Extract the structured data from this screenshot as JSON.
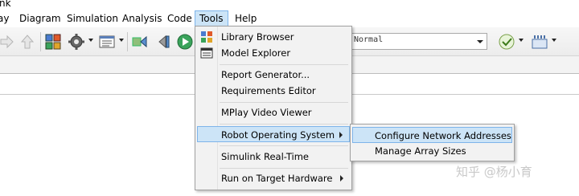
{
  "window": {
    "title_fragment": "nk"
  },
  "menubar": {
    "items": [
      {
        "label": "ay"
      },
      {
        "label": "Diagram"
      },
      {
        "label": "Simulation"
      },
      {
        "label": "Analysis"
      },
      {
        "label": "Code"
      },
      {
        "label": "Tools"
      },
      {
        "label": "Help"
      }
    ],
    "active": "Tools"
  },
  "toolbar": {
    "simulation_mode": "Normal"
  },
  "tools_menu": {
    "items": [
      {
        "label": "Library Browser"
      },
      {
        "label": "Model Explorer"
      },
      {
        "label": "Report Generator..."
      },
      {
        "label": "Requirements Editor"
      },
      {
        "label": "MPlay Video Viewer"
      },
      {
        "label": "Robot Operating System"
      },
      {
        "label": "Simulink Real-Time"
      },
      {
        "label": "Run on Target Hardware"
      }
    ],
    "highlighted": "Robot Operating System"
  },
  "ros_submenu": {
    "items": [
      {
        "label": "Configure Network Addresses"
      },
      {
        "label": "Manage Array Sizes"
      }
    ],
    "highlighted": "Configure Network Addresses"
  },
  "watermark": "知乎 @杨小育",
  "colors": {
    "highlight": "#cce4f7",
    "highlight_border": "#7eb4ea",
    "menu_bg": "#f2f2f2"
  }
}
